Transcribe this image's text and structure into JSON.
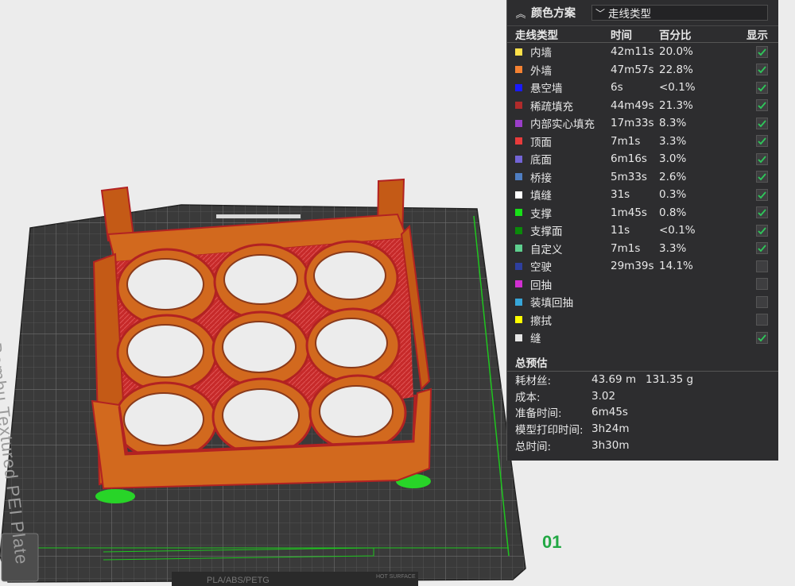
{
  "viewport": {
    "plate_label": "Bambu Textured PEI Plate",
    "plate_number": "01",
    "bed_tag": "PLA/ABS/PETG",
    "bed_tag_small": "HOT SURFACE"
  },
  "panel": {
    "title": "颜色方案",
    "scheme_value": "走线类型",
    "columns": {
      "type": "走线类型",
      "time": "时间",
      "percent": "百分比",
      "show": "显示"
    },
    "rows": [
      {
        "name": "内墙",
        "time": "42m11s",
        "percent": "20.0%",
        "color": "#ffe14a",
        "checked": true
      },
      {
        "name": "外墙",
        "time": "47m57s",
        "percent": "22.8%",
        "color": "#f58232",
        "checked": true
      },
      {
        "name": "悬空墙",
        "time": "6s",
        "percent": "<0.1%",
        "color": "#1a1aff",
        "checked": true
      },
      {
        "name": "稀疏填充",
        "time": "44m49s",
        "percent": "21.3%",
        "color": "#b02b2b",
        "checked": true
      },
      {
        "name": "内部实心填充",
        "time": "17m33s",
        "percent": "8.3%",
        "color": "#9a3ec9",
        "checked": true
      },
      {
        "name": "顶面",
        "time": "7m1s",
        "percent": "3.3%",
        "color": "#e83b3b",
        "checked": true
      },
      {
        "name": "底面",
        "time": "6m16s",
        "percent": "3.0%",
        "color": "#7364d6",
        "checked": true
      },
      {
        "name": "桥接",
        "time": "5m33s",
        "percent": "2.6%",
        "color": "#4f7ec2",
        "checked": true
      },
      {
        "name": "填缝",
        "time": "31s",
        "percent": "0.3%",
        "color": "#ffffff",
        "checked": true
      },
      {
        "name": "支撑",
        "time": "1m45s",
        "percent": "0.8%",
        "color": "#18e018",
        "checked": true
      },
      {
        "name": "支撑面",
        "time": "11s",
        "percent": "<0.1%",
        "color": "#0a8a0a",
        "checked": true
      },
      {
        "name": "自定义",
        "time": "7m1s",
        "percent": "3.3%",
        "color": "#5ecf8e",
        "checked": true
      },
      {
        "name": "空驶",
        "time": "29m39s",
        "percent": "14.1%",
        "color": "#2e3f9e",
        "checked": false
      },
      {
        "name": "回抽",
        "time": "",
        "percent": "",
        "color": "#d12fd1",
        "checked": false
      },
      {
        "name": "装填回抽",
        "time": "",
        "percent": "",
        "color": "#37a6d9",
        "checked": false
      },
      {
        "name": "擦拭",
        "time": "",
        "percent": "",
        "color": "#ffff00",
        "checked": false
      },
      {
        "name": "缝",
        "time": "",
        "percent": "",
        "color": "#e6e6e6",
        "checked": true
      }
    ],
    "estimate_title": "总预估",
    "estimates": [
      {
        "label": "耗材丝:",
        "v1": "43.69 m",
        "v2": "131.35 g"
      },
      {
        "label": "成本:",
        "v1": "3.02",
        "v2": ""
      },
      {
        "label": "准备时间:",
        "v1": "6m45s",
        "v2": ""
      },
      {
        "label": "模型打印时间:",
        "v1": "3h24m",
        "v2": ""
      },
      {
        "label": "总时间:",
        "v1": "3h30m",
        "v2": ""
      }
    ]
  }
}
